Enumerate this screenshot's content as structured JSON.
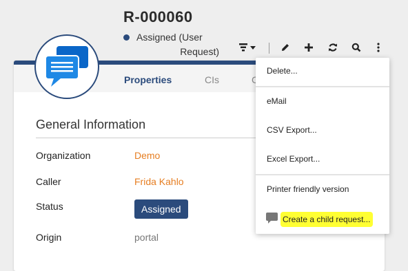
{
  "header": {
    "ref": "R-000060",
    "status_line1": "Assigned (User",
    "status_line2": "Request)"
  },
  "toolbar": {
    "icons": [
      "filter-dropdown-icon",
      "pencil-icon",
      "plus-icon",
      "refresh-icon",
      "search-icon",
      "more-vertical-icon"
    ]
  },
  "tabs": [
    {
      "label": "Properties"
    },
    {
      "label": "CIs"
    },
    {
      "label": "C"
    }
  ],
  "section": {
    "title": "General Information"
  },
  "fields": [
    {
      "label": "Organization",
      "value": "Demo"
    },
    {
      "label": "Caller",
      "value": "Frida Kahlo"
    },
    {
      "label": "Status",
      "value": "Assigned"
    },
    {
      "label": "Origin",
      "value": "portal"
    }
  ],
  "menu": {
    "items": [
      {
        "label": "Delete..."
      },
      {
        "label": "eMail"
      },
      {
        "label": "CSV Export..."
      },
      {
        "label": "Excel Export..."
      },
      {
        "label": "Printer friendly version"
      },
      {
        "label": "Create a child request..."
      }
    ]
  },
  "colors": {
    "brand": "#2b4b7c",
    "link": "#e67e22",
    "highlight": "#ffff33"
  }
}
